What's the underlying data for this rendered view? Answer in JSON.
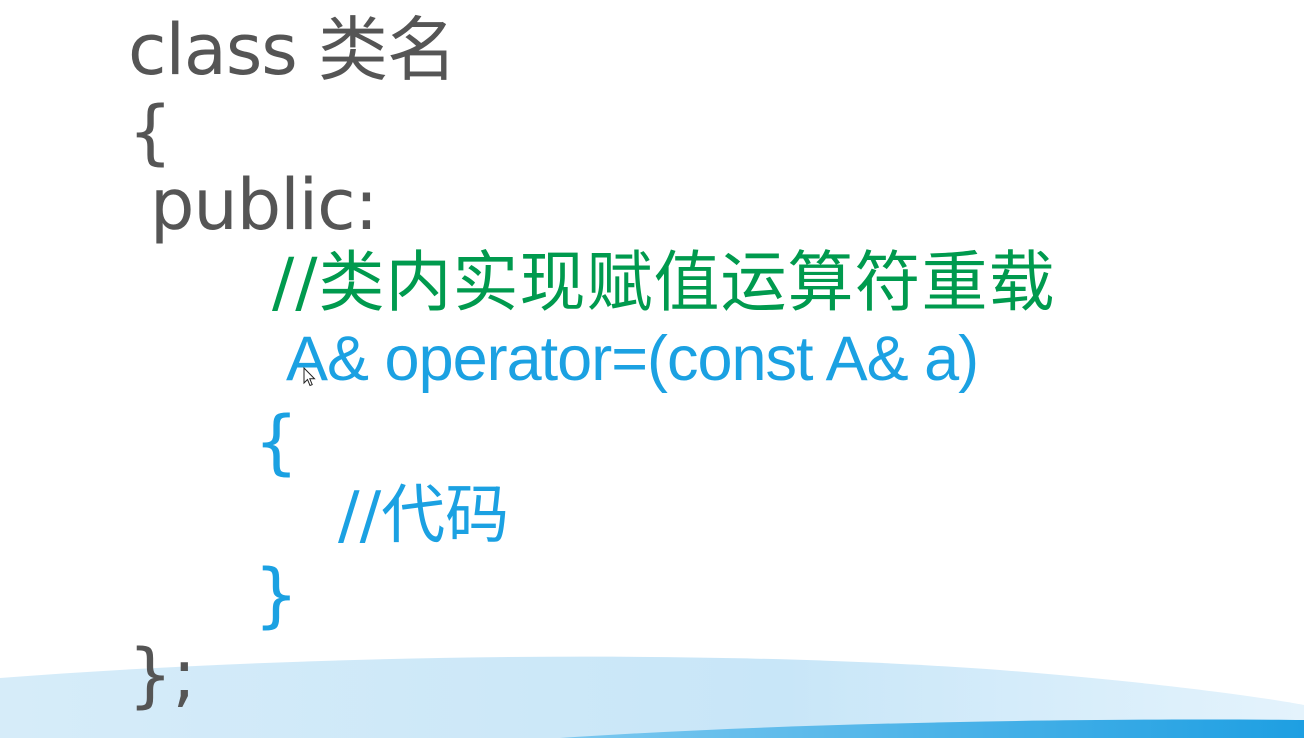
{
  "slide": {
    "lines": [
      "class 类名",
      "{",
      "public:",
      "//类内实现赋值运算符重载",
      "A& operator=(const A& a)",
      "{",
      "//代码",
      "}",
      "};"
    ]
  },
  "colors": {
    "default_text": "#555555",
    "comment_green": "#009a4e",
    "code_blue": "#1ba1e2",
    "wave_light": "#cfe9f8",
    "wave_dark": "#29a3e3"
  },
  "icons": {
    "cursor": "mouse-pointer-icon"
  }
}
